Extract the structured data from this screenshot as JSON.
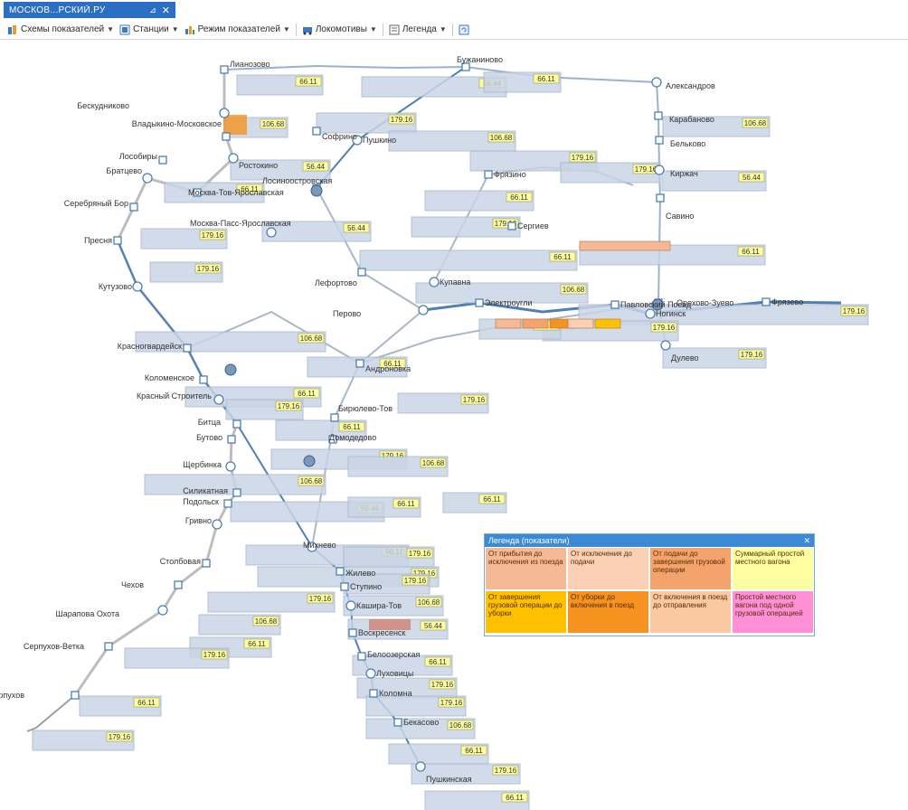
{
  "tab": {
    "title": "МОСКОВ...РСКИЙ.РУ",
    "pin": "⊿",
    "close": "✕"
  },
  "toolbar": {
    "items": [
      {
        "label": "Схемы показателей",
        "icon": "schemes-icon"
      },
      {
        "label": "Станции",
        "icon": "stations-icon"
      },
      {
        "label": "Режим показателей",
        "icon": "mode-icon"
      },
      {
        "label": "Локомотивы",
        "icon": "locomotives-icon"
      },
      {
        "label": "Легенда",
        "icon": "legend-icon"
      }
    ],
    "refresh_icon": "refresh-icon"
  },
  "legend": {
    "title": "Легенда (показатели)",
    "close": "✕",
    "cells": [
      {
        "text": "От прибытия до исключения из поезда",
        "color": "#f6b998"
      },
      {
        "text": "От исключения до подачи",
        "color": "#fcd0b5"
      },
      {
        "text": "От подачи до завершения грузовой операции",
        "color": "#f4a36c"
      },
      {
        "text": "Суммарный простой местного вагона",
        "color": "#fefea0"
      },
      {
        "text": "От завершения грузовой операции до уборки",
        "color": "#ffc000"
      },
      {
        "text": "От уборки до включения в поезд",
        "color": "#f59220"
      },
      {
        "text": "От включения в поезд до отправления",
        "color": "#fbc8a4"
      },
      {
        "text": "Простой местного вагона под одной грузовой операцией",
        "color": "#ff90d8"
      }
    ]
  },
  "stations": [
    {
      "name": "Бескудниково"
    },
    {
      "name": "Владыкино-Московское"
    },
    {
      "name": "Лособиры"
    },
    {
      "name": "Братцево"
    },
    {
      "name": "Серебряный Бор"
    },
    {
      "name": "Пресня"
    },
    {
      "name": "Кутузово"
    },
    {
      "name": "Красногвардейск"
    },
    {
      "name": "Коломенское"
    },
    {
      "name": "Красный Строитель"
    },
    {
      "name": "Битца"
    },
    {
      "name": "Бутово"
    },
    {
      "name": "Щербинка"
    },
    {
      "name": "Силикатная"
    },
    {
      "name": "Подольск"
    },
    {
      "name": "Гривно"
    },
    {
      "name": "Столбовая"
    },
    {
      "name": "Чехов"
    },
    {
      "name": "Шарапова Охота"
    },
    {
      "name": "Серпухов-Ветка"
    },
    {
      "name": "Серпухов"
    },
    {
      "name": "Александров"
    },
    {
      "name": "Карабаново"
    },
    {
      "name": "Бельково"
    },
    {
      "name": "Киржач"
    },
    {
      "name": "Савино"
    },
    {
      "name": "Орехово-Зуево"
    },
    {
      "name": "Дулево"
    },
    {
      "name": "Лианозово"
    },
    {
      "name": "Софрино"
    },
    {
      "name": "Ростокино"
    },
    {
      "name": "Лосиноостровская"
    },
    {
      "name": "Москва-Тов-Ярославская"
    },
    {
      "name": "Москва-Пасс-Ярославская"
    },
    {
      "name": "Лефортово"
    },
    {
      "name": "Андроновка"
    },
    {
      "name": "Перово"
    },
    {
      "name": "Бирюлево-Тов"
    },
    {
      "name": "Домодедово"
    },
    {
      "name": "Михнево"
    },
    {
      "name": "Жилево"
    },
    {
      "name": "Ступино"
    },
    {
      "name": "Каширa-Тов"
    },
    {
      "name": "Воскресенск"
    },
    {
      "name": "Белоозерская"
    },
    {
      "name": "Луховицы"
    },
    {
      "name": "Коломна"
    },
    {
      "name": "Бекасово"
    },
    {
      "name": "Пушкино"
    },
    {
      "name": "Фрязино"
    },
    {
      "name": "Сергиев"
    },
    {
      "name": "Купавна"
    },
    {
      "name": "Электроугли"
    },
    {
      "name": "Павловский Посад"
    },
    {
      "name": "Ногинск"
    },
    {
      "name": "Фрязево"
    },
    {
      "name": "Бужаниново"
    },
    {
      "name": "Пушкинская"
    }
  ],
  "values": [
    "66.11",
    "179.16",
    "106.68",
    "56.44",
    "66.11",
    "179.16",
    "179.16",
    "106.68",
    "66.11",
    "179.16"
  ]
}
